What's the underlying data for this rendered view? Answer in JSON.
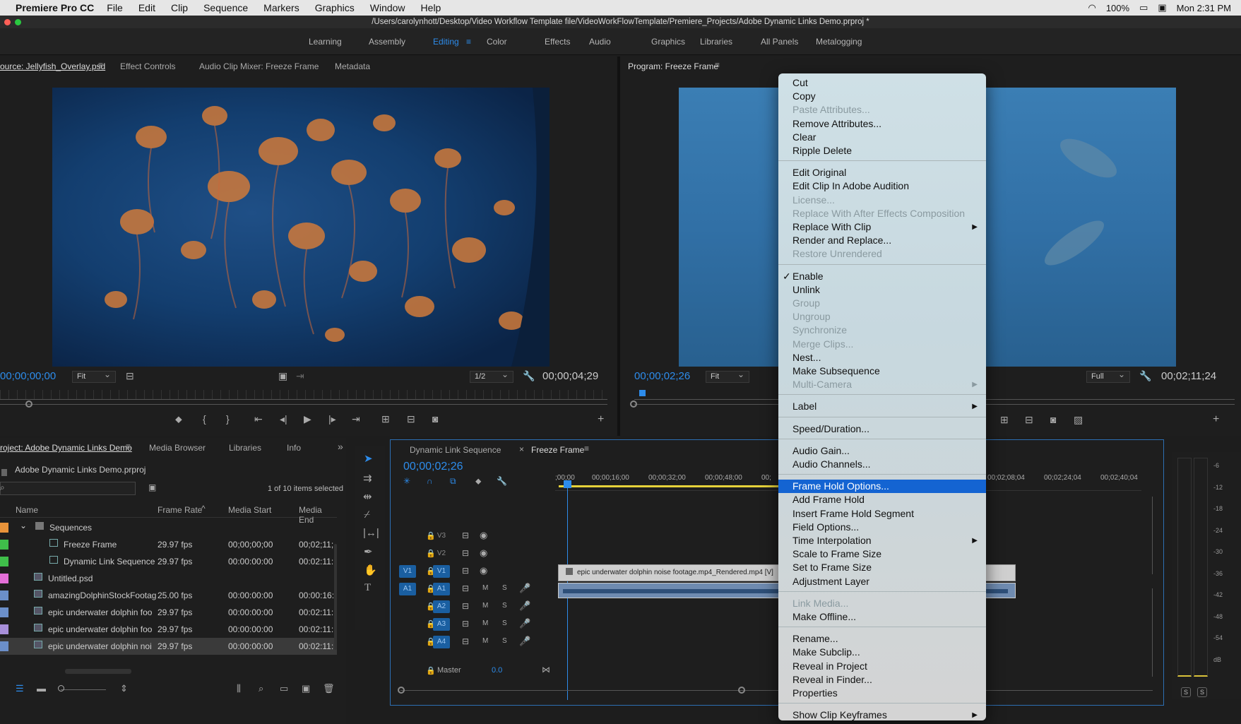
{
  "menubar": {
    "app": "Premiere Pro CC",
    "items": [
      "File",
      "Edit",
      "Clip",
      "Sequence",
      "Markers",
      "Graphics",
      "Window",
      "Help"
    ],
    "battery": "100%",
    "clock": "Mon 2:31 PM"
  },
  "titlebar": {
    "path": "/Users/carolynhott/Desktop/Video Workflow Template file/VideoWorkFlowTemplate/Premiere_Projects/Adobe Dynamic Links Demo.prproj *"
  },
  "workspaces": [
    "Learning",
    "Assembly",
    "Editing",
    "Color",
    "Effects",
    "Audio",
    "Graphics",
    "Libraries",
    "All Panels",
    "Metalogging"
  ],
  "active_workspace": "Editing",
  "source_panel": {
    "tabs": [
      "ource: Jellyfish_Overlay.psd",
      "Effect Controls",
      "Audio Clip Mixer: Freeze Frame",
      "Metadata"
    ],
    "timecode_in": "00;00;00;00",
    "fit": "Fit",
    "resolution": "1/2",
    "duration": "00;00;04;29"
  },
  "program_panel": {
    "title": "Program: Freeze Frame",
    "timecode": "00;00;02;26",
    "fit": "Fit",
    "resolution": "Full",
    "duration": "00;02;11;24"
  },
  "project_panel": {
    "tabs": [
      "roject: Adobe Dynamic Links Demo",
      "Media Browser",
      "Libraries",
      "Info"
    ],
    "project_file": "Adobe Dynamic Links Demo.prproj",
    "selection": "1 of 10 items selected",
    "columns": [
      "Name",
      "Frame Rate",
      "Media Start",
      "Media End"
    ],
    "rows": [
      {
        "name": "Sequences",
        "rate": "",
        "start": "",
        "end": "",
        "color": "#e8933a"
      },
      {
        "name": "Freeze Frame",
        "rate": "29.97 fps",
        "start": "00;00;00;00",
        "end": "00;02;11;",
        "color": "#3fbf4a"
      },
      {
        "name": "Dynamic Link Sequence",
        "rate": "29.97 fps",
        "start": "00:00:00:00",
        "end": "00:02:11:",
        "color": "#3fbf4a"
      },
      {
        "name": "Untitled.psd",
        "rate": "",
        "start": "",
        "end": "",
        "color": "#e36fd7"
      },
      {
        "name": "amazingDolphinStockFootag",
        "rate": "25.00 fps",
        "start": "00:00:00:00",
        "end": "00:00:16:",
        "color": "#6b8fc9"
      },
      {
        "name": "epic underwater dolphin foo",
        "rate": "29.97 fps",
        "start": "00:00:00:00",
        "end": "00:02:11:",
        "color": "#6b8fc9"
      },
      {
        "name": "epic underwater dolphin foo",
        "rate": "29.97 fps",
        "start": "00:00:00:00",
        "end": "00:02:11:",
        "color": "#a78fd9"
      },
      {
        "name": "epic underwater dolphin noi",
        "rate": "29.97 fps",
        "start": "00:00:00:00",
        "end": "00:02:11:",
        "color": "#6b8fc9"
      }
    ]
  },
  "timeline": {
    "tabs": [
      "Dynamic Link Sequence",
      "Freeze Frame"
    ],
    "timecode": "00;00;02;26",
    "ruler": [
      ";00;00",
      "00;00;16;00",
      "00;00;32;00",
      "00;00;48;00",
      "00;",
      "00;02;08;04",
      "00;02;24;04",
      "00;02;40;04"
    ],
    "video_tracks": [
      "V3",
      "V2",
      "V1"
    ],
    "audio_tracks": [
      "A1",
      "A2",
      "A3",
      "A4"
    ],
    "source_patch_v": "V1",
    "source_patch_a": "A1",
    "clip_label": "epic underwater dolphin noise footage.mp4_Rendered.mp4 [V]",
    "master_label": "Master",
    "master_value": "0.0"
  },
  "meter": {
    "labels": [
      "-6",
      "-12",
      "-18",
      "-24",
      "-30",
      "-36",
      "-42",
      "-48",
      "-54",
      "dB"
    ],
    "solo": [
      "S",
      "S"
    ]
  },
  "context_menu": {
    "groups": [
      [
        {
          "label": "Cut"
        },
        {
          "label": "Copy"
        },
        {
          "label": "Paste Attributes...",
          "disabled": true
        },
        {
          "label": "Remove Attributes..."
        },
        {
          "label": "Clear"
        },
        {
          "label": "Ripple Delete"
        }
      ],
      [
        {
          "label": "Edit Original"
        },
        {
          "label": "Edit Clip In Adobe Audition"
        },
        {
          "label": "License...",
          "disabled": true
        },
        {
          "label": "Replace With After Effects Composition",
          "disabled": true
        },
        {
          "label": "Replace With Clip",
          "submenu": true
        },
        {
          "label": "Render and Replace..."
        },
        {
          "label": "Restore Unrendered",
          "disabled": true
        }
      ],
      [
        {
          "label": "Enable",
          "checked": true
        },
        {
          "label": "Unlink"
        },
        {
          "label": "Group",
          "disabled": true
        },
        {
          "label": "Ungroup",
          "disabled": true
        },
        {
          "label": "Synchronize",
          "disabled": true
        },
        {
          "label": "Merge Clips...",
          "disabled": true
        },
        {
          "label": "Nest..."
        },
        {
          "label": "Make Subsequence"
        },
        {
          "label": "Multi-Camera",
          "disabled": true,
          "submenu": true
        }
      ],
      [
        {
          "label": "Label",
          "submenu": true
        }
      ],
      [
        {
          "label": "Speed/Duration..."
        }
      ],
      [
        {
          "label": "Audio Gain..."
        },
        {
          "label": "Audio Channels..."
        }
      ],
      [
        {
          "label": "Frame Hold Options...",
          "highlighted": true
        },
        {
          "label": "Add Frame Hold"
        },
        {
          "label": "Insert Frame Hold Segment"
        },
        {
          "label": "Field Options..."
        },
        {
          "label": "Time Interpolation",
          "submenu": true
        },
        {
          "label": "Scale to Frame Size"
        },
        {
          "label": "Set to Frame Size"
        },
        {
          "label": "Adjustment Layer"
        }
      ],
      [
        {
          "label": "Link Media...",
          "disabled": true
        },
        {
          "label": "Make Offline..."
        }
      ],
      [
        {
          "label": "Rename..."
        },
        {
          "label": "Make Subclip..."
        },
        {
          "label": "Reveal in Project"
        },
        {
          "label": "Reveal in Finder..."
        },
        {
          "label": "Properties"
        }
      ],
      [
        {
          "label": "Show Clip Keyframes",
          "submenu": true
        }
      ]
    ]
  }
}
